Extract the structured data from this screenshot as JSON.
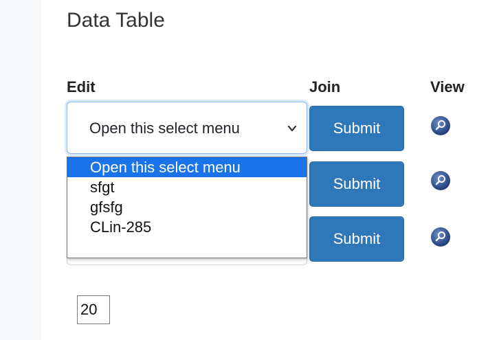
{
  "title": "Data Table",
  "columns": {
    "edit": "Edit",
    "join": "Join",
    "view": "View"
  },
  "select": {
    "value": "Open this select menu",
    "options": [
      "Open this select menu",
      "sfgt",
      "gfsfg",
      "CLin-285"
    ],
    "selected_index": 0
  },
  "rows": [
    {
      "submit_label": "Submit",
      "view_icon": "magnifier-icon"
    },
    {
      "submit_label": "Submit",
      "view_icon": "magnifier-icon"
    },
    {
      "submit_label": "Submit",
      "view_icon": "magnifier-icon"
    }
  ],
  "pagination": {
    "page_size": "20"
  },
  "colors": {
    "submit_bg": "#2e77b8",
    "option_highlight": "#1a73e8",
    "focus_border": "#86b7fe"
  }
}
